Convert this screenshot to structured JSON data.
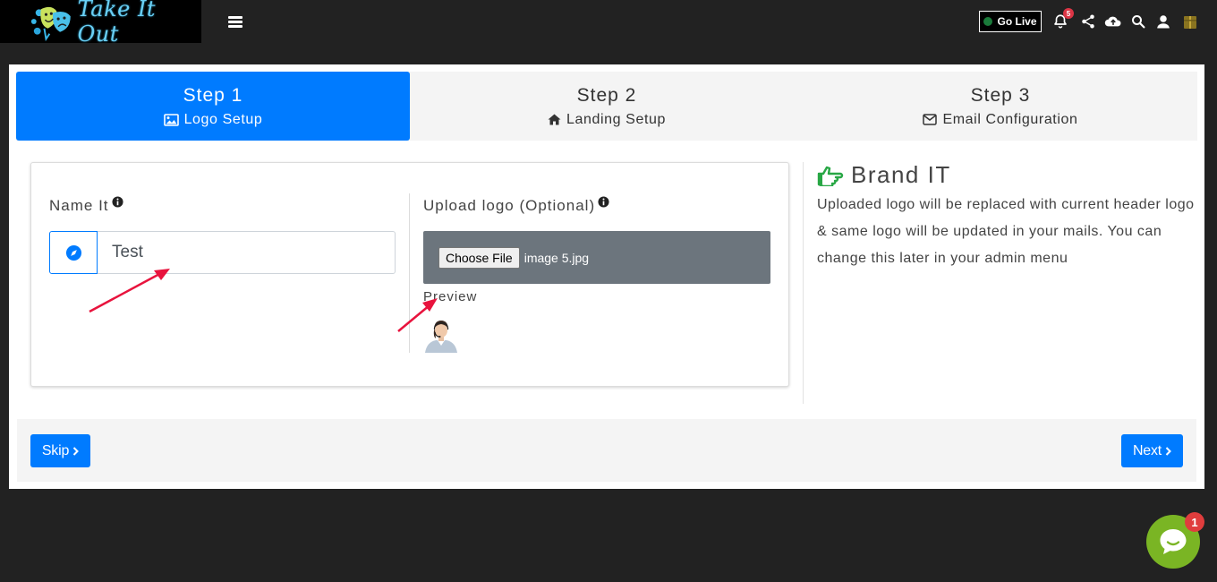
{
  "header": {
    "brand": "Take It Out",
    "go_live_label": "Go Live",
    "notification_count": "5",
    "icons": [
      "bars-icon",
      "bell-icon",
      "share-icon",
      "cloud-upload-icon",
      "search-icon",
      "user-icon",
      "gift-icon"
    ]
  },
  "steps": [
    {
      "title": "Step 1",
      "label": "Logo Setup",
      "icon": "image-icon",
      "active": true
    },
    {
      "title": "Step 2",
      "label": "Landing Setup",
      "icon": "home-icon",
      "active": false
    },
    {
      "title": "Step 3",
      "label": "Email Configuration",
      "icon": "envelope-icon",
      "active": false
    }
  ],
  "form": {
    "name_label": "Name It",
    "name_value": "Test",
    "upload_label": "Upload logo (Optional)",
    "choose_file_label": "Choose File",
    "file_name": "image 5.jpg",
    "preview_label": "Preview"
  },
  "brand_panel": {
    "title": "Brand IT",
    "text": "Uploaded logo will be replaced with current header logo & same logo will be updated in your mails. You can change this later in your admin menu"
  },
  "footer": {
    "skip_label": "Skip",
    "next_label": "Next"
  },
  "chat": {
    "badge_count": "1"
  },
  "colors": {
    "primary": "#007bff",
    "brand_icon": "#28a745",
    "chat": "#7ab524",
    "annotation_arrow": "#e8133d"
  }
}
